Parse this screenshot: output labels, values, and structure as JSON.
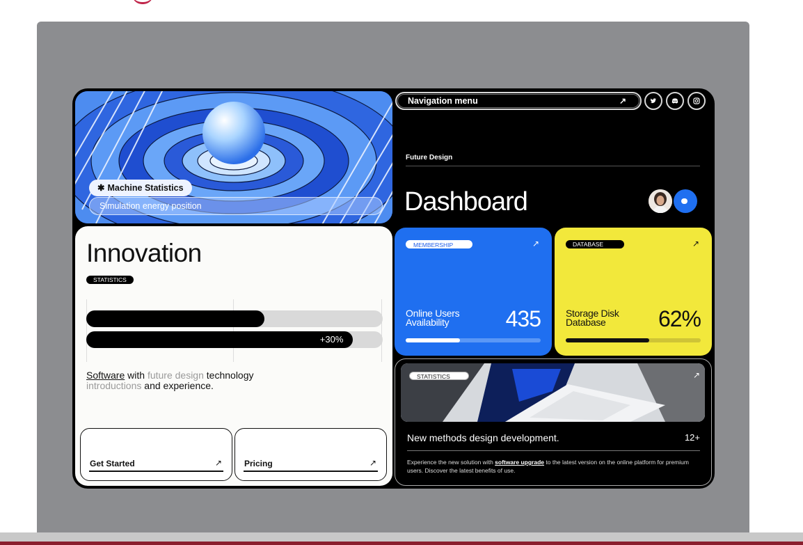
{
  "hero": {
    "machine_label": "Machine Statistics",
    "simulation_label": "Simulation energy position"
  },
  "nav": {
    "menu_label": "Navigation menu",
    "social": [
      "twitter-icon",
      "discord-icon",
      "instagram-icon"
    ]
  },
  "header": {
    "eyebrow": "Future Design",
    "title": "Dashboard"
  },
  "innovation": {
    "title": "Innovation",
    "tag": "STATISTICS",
    "bar1_fill": 0.6,
    "bar2_fill": 0.9,
    "bar2_label": "+30%",
    "text_parts": [
      "Software",
      " with ",
      "future design",
      " technology ",
      "introductions",
      " and experience."
    ],
    "buttons": [
      {
        "label": "Get Started",
        "icon": "arrow-up-right-icon"
      },
      {
        "label": "Pricing",
        "icon": "arrow-up-right-icon"
      }
    ]
  },
  "membership": {
    "tag": "MEMBERSHIP",
    "label_line1": "Online Users",
    "label_line2": "Availability",
    "value": "435",
    "progress": 0.4,
    "color": "#1f6ff0"
  },
  "database": {
    "tag": "DATABASE",
    "label_line1": "Storage Disk",
    "label_line2": "Database",
    "value": "62%",
    "progress": 0.62,
    "color": "#f2e83b"
  },
  "statistics": {
    "tag": "STATISTICS",
    "headline": "New methods design development.",
    "count": "12+",
    "desc_before": "Experience the new solution with ",
    "desc_link": "software upgrade",
    "desc_after": " to the latest version on the online platform for premium users. Discover the latest benefits of use."
  }
}
